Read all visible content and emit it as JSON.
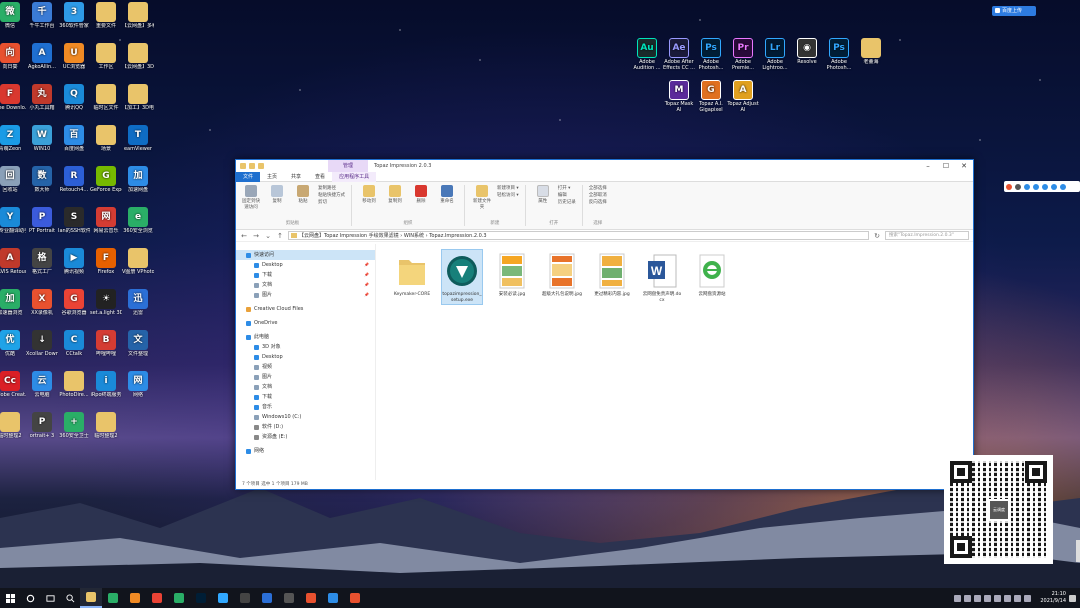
{
  "desktop": {
    "left_icons": [
      {
        "label": "微信",
        "color": "#2aae67",
        "glyph": "微"
      },
      {
        "label": "千牛工作台",
        "color": "#3a7bd5",
        "glyph": "千"
      },
      {
        "label": "360软件管家",
        "color": "#2e9ae6",
        "glyph": "3"
      },
      {
        "label": "重要文件",
        "color": "#e9c46a",
        "glyph": ""
      },
      {
        "label": "【云网盘】多种模式...",
        "color": "#e9c46a",
        "glyph": ""
      },
      {
        "label": "向日葵",
        "color": "#e8512f",
        "glyph": "向"
      },
      {
        "label": "AgkoAllin...",
        "color": "#1f6fd1",
        "glyph": "A"
      },
      {
        "label": "UC浏览器",
        "color": "#f08a24",
        "glyph": "U"
      },
      {
        "label": "工作区",
        "color": "#e9c46a",
        "glyph": ""
      },
      {
        "label": "【云网盘】3D电视...",
        "color": "#e9c46a",
        "glyph": ""
      },
      {
        "label": "Free Downlo...",
        "color": "#d9382f",
        "glyph": "F"
      },
      {
        "label": "小丸工具箱",
        "color": "#c0392b",
        "glyph": "丸"
      },
      {
        "label": "腾讯QQ",
        "color": "#1a8ad8",
        "glyph": "Q"
      },
      {
        "label": "临时区文件",
        "color": "#e9c46a",
        "glyph": ""
      },
      {
        "label": "【加工】3D电视...",
        "color": "#e9c46a",
        "glyph": ""
      },
      {
        "label": "青萌Zeon",
        "color": "#1a9be6",
        "glyph": "Z"
      },
      {
        "label": "WIN10",
        "color": "#3aa0d8",
        "glyph": "W"
      },
      {
        "label": "百度网盘",
        "color": "#2d8ce6",
        "glyph": "百"
      },
      {
        "label": "场景",
        "color": "#e9c46a",
        "glyph": ""
      },
      {
        "label": "eamViewer",
        "color": "#0e6cc4",
        "glyph": "T"
      },
      {
        "label": "回收站",
        "color": "#8aa0b8",
        "glyph": "回"
      },
      {
        "label": "数大师",
        "color": "#2563a8",
        "glyph": "数"
      },
      {
        "label": "Retouch4...",
        "color": "#2c5fd6",
        "glyph": "R"
      },
      {
        "label": "GeForce Experience",
        "color": "#76b900",
        "glyph": "G"
      },
      {
        "label": "加速网盘",
        "color": "#2d8ce6",
        "glyph": "加"
      },
      {
        "label": "有专业翻译助手",
        "color": "#1a8ad8",
        "glyph": "Y"
      },
      {
        "label": "PT Portrait",
        "color": "#3b5bdb",
        "glyph": "P"
      },
      {
        "label": "Ian的SSH软件",
        "color": "#2a2a2a",
        "glyph": "S"
      },
      {
        "label": "网易云音乐",
        "color": "#d43c33",
        "glyph": "网"
      },
      {
        "label": "360安全浏览",
        "color": "#2aae67",
        "glyph": "e"
      },
      {
        "label": "ARVIS Retoucher",
        "color": "#c0392b",
        "glyph": "A"
      },
      {
        "label": "格式工厂",
        "color": "#444",
        "glyph": "格"
      },
      {
        "label": "腾讯视频",
        "color": "#1a8ad8",
        "glyph": "▶"
      },
      {
        "label": "Firefox",
        "color": "#e66000",
        "glyph": "F"
      },
      {
        "label": "V图册 VPhoto看图",
        "color": "#e9c46a",
        "glyph": ""
      },
      {
        "label": "加速器浏览",
        "color": "#2aae67",
        "glyph": "加"
      },
      {
        "label": "XX录像机",
        "color": "#e8512f",
        "glyph": "X"
      },
      {
        "label": "谷歌浏览器",
        "color": "#ea4335",
        "glyph": "G"
      },
      {
        "label": "set.a.light 3D V2.5",
        "color": "#222",
        "glyph": "☀"
      },
      {
        "label": "迅雷",
        "color": "#2b6fd6",
        "glyph": "迅"
      },
      {
        "label": "优酷",
        "color": "#1fa3e8",
        "glyph": "优"
      },
      {
        "label": "Xcollar Downlo...",
        "color": "#333",
        "glyph": "↓"
      },
      {
        "label": "CCtalk",
        "color": "#1a8ad8",
        "glyph": "C"
      },
      {
        "label": "哔哩哔哩",
        "color": "#d43c33",
        "glyph": "B"
      },
      {
        "label": "文件整理",
        "color": "#2563a8",
        "glyph": "文"
      },
      {
        "label": "Adobe Creat...",
        "color": "#da1f26",
        "glyph": "Cc"
      },
      {
        "label": "云电脑",
        "color": "#2d8ce6",
        "glyph": "云"
      },
      {
        "label": "PhotoDire...",
        "color": "#e9c46a",
        "glyph": ""
      },
      {
        "label": "iRpo终端服务",
        "color": "#1a8ad8",
        "glyph": "i"
      },
      {
        "label": "网络",
        "color": "#2d8ce6",
        "glyph": "网"
      },
      {
        "label": "临时整理2",
        "color": "#e9c46a",
        "glyph": ""
      },
      {
        "label": "ortrait+ 3",
        "color": "#444",
        "glyph": "P"
      },
      {
        "label": "360安全卫士",
        "color": "#2aae67",
        "glyph": "+"
      },
      {
        "label": "临时整理2",
        "color": "#e9c46a",
        "glyph": ""
      }
    ],
    "right_icons": [
      {
        "label": "Adobe Audition ...",
        "color": "#00e4bb",
        "glyph": "Au",
        "bg": "#1a2a2a"
      },
      {
        "label": "Adobe After Effects CC ...",
        "color": "#9999ff",
        "glyph": "Ae",
        "bg": "#1a1a3a"
      },
      {
        "label": "Adobe Photosh...",
        "color": "#31a8ff",
        "glyph": "Ps",
        "bg": "#001e36"
      },
      {
        "label": "Adobe Premie...",
        "color": "#ea77ff",
        "glyph": "Pr",
        "bg": "#2a0a3a"
      },
      {
        "label": "Adobe Lightroo...",
        "color": "#31a8ff",
        "glyph": "Lr",
        "bg": "#001a33"
      },
      {
        "label": "Resolve",
        "color": "#fff",
        "glyph": "◉",
        "bg": "#333"
      },
      {
        "label": "Adobe Photosh...",
        "color": "#31a8ff",
        "glyph": "Ps",
        "bg": "#001e36"
      },
      {
        "label": "老董海",
        "color": "#e9c46a",
        "glyph": "",
        "bg": "#e9c46a"
      },
      {
        "label": "Topaz Mask AI",
        "color": "#fff",
        "glyph": "M",
        "bg": "#5b2b9a"
      },
      {
        "label": "Topaz A.I. Gigapixel",
        "color": "#fff",
        "glyph": "G",
        "bg": "#e07020"
      },
      {
        "label": "Topaz Adjust AI",
        "color": "#fff",
        "glyph": "A",
        "bg": "#e0a020"
      }
    ],
    "top_badge": "百度上传",
    "qr_logo_text": "云调度"
  },
  "window": {
    "manage_tab": "管理",
    "title": "Topaz Impression 2.0.3",
    "controls": [
      "–",
      "☐",
      "✕"
    ],
    "tabs": [
      "文件",
      "主页",
      "共享",
      "查看",
      "应用程序工具"
    ],
    "ribbon": {
      "clipboard": {
        "label": "剪贴板",
        "buttons": [
          "固定到快速访问",
          "复制",
          "粘贴"
        ],
        "small": [
          "复制路径",
          "粘贴快捷方式",
          "剪切"
        ]
      },
      "organize": {
        "label": "组织",
        "buttons": [
          "移动到",
          "复制到",
          "删除",
          "重命名"
        ]
      },
      "new": {
        "label": "新建",
        "buttons": [
          "新建文件夹"
        ],
        "small": [
          "新建项目 ▾",
          "轻松访问 ▾"
        ]
      },
      "open": {
        "label": "打开",
        "buttons": [
          "属性"
        ],
        "small": [
          "打开 ▾",
          "编辑",
          "历史记录"
        ]
      },
      "select": {
        "label": "选择",
        "small": [
          "全部选择",
          "全部取消",
          "反向选择"
        ]
      }
    },
    "address": "【云网盘】Topaz Impression 手绘效果滤镜  ›  WIN系统  ›  Topaz.Impression.2.0.3",
    "search_placeholder": "搜索\"Topaz.Impression.2.0.3\"",
    "nav": [
      {
        "label": "快速访问",
        "color": "#2d8ce6",
        "sub": false,
        "sel": true,
        "pin": false
      },
      {
        "label": "Desktop",
        "color": "#2d8ce6",
        "sub": true,
        "sel": false,
        "pin": true
      },
      {
        "label": "下载",
        "color": "#2d8ce6",
        "sub": true,
        "sel": false,
        "pin": true
      },
      {
        "label": "文档",
        "color": "#8aa0b8",
        "sub": true,
        "sel": false,
        "pin": true
      },
      {
        "label": "图片",
        "color": "#8aa0b8",
        "sub": true,
        "sel": false,
        "pin": true
      },
      {
        "label": "",
        "gap": true
      },
      {
        "label": "Creative Cloud Files",
        "color": "#e9a13a",
        "sub": false,
        "sel": false,
        "pin": false
      },
      {
        "label": "",
        "gap": true
      },
      {
        "label": "OneDrive",
        "color": "#2d8ce6",
        "sub": false,
        "sel": false,
        "pin": false
      },
      {
        "label": "",
        "gap": true
      },
      {
        "label": "此电脑",
        "color": "#2d8ce6",
        "sub": false,
        "sel": false,
        "pin": false
      },
      {
        "label": "3D 对象",
        "color": "#2d8ce6",
        "sub": true,
        "sel": false,
        "pin": false
      },
      {
        "label": "Desktop",
        "color": "#2d8ce6",
        "sub": true,
        "sel": false,
        "pin": false
      },
      {
        "label": "视频",
        "color": "#8aa0b8",
        "sub": true,
        "sel": false,
        "pin": false
      },
      {
        "label": "图片",
        "color": "#8aa0b8",
        "sub": true,
        "sel": false,
        "pin": false
      },
      {
        "label": "文档",
        "color": "#8aa0b8",
        "sub": true,
        "sel": false,
        "pin": false
      },
      {
        "label": "下载",
        "color": "#2d8ce6",
        "sub": true,
        "sel": false,
        "pin": false
      },
      {
        "label": "音乐",
        "color": "#2d8ce6",
        "sub": true,
        "sel": false,
        "pin": false
      },
      {
        "label": "Windows10 (C:)",
        "color": "#8aa0b8",
        "sub": true,
        "sel": false,
        "pin": false
      },
      {
        "label": "软件 (D:)",
        "color": "#888",
        "sub": true,
        "sel": false,
        "pin": false
      },
      {
        "label": "资源盘 (E:)",
        "color": "#888",
        "sub": true,
        "sel": false,
        "pin": false
      },
      {
        "label": "",
        "gap": true
      },
      {
        "label": "网络",
        "color": "#2d8ce6",
        "sub": false,
        "sel": false,
        "pin": false
      }
    ],
    "files": [
      {
        "name": "Keymaker-CORE",
        "kind": "folder",
        "selected": false
      },
      {
        "name": "topazimpression_setup.exe",
        "kind": "exe",
        "selected": true
      },
      {
        "name": "安装必读.jpg",
        "kind": "img1",
        "selected": false
      },
      {
        "name": "超级大礼包说明.jpg",
        "kind": "img2",
        "selected": false
      },
      {
        "name": "更过精彩内容.jpg",
        "kind": "img3",
        "selected": false
      },
      {
        "name": "云网盘免责声明.docx",
        "kind": "word",
        "selected": false
      },
      {
        "name": "云网盘资源站",
        "kind": "ie",
        "selected": false
      }
    ],
    "status": "7 个项目    选中 1 个项目  179 MB"
  },
  "taskbar": {
    "apps": [
      {
        "color": "#e9c46a",
        "active": true
      },
      {
        "color": "#2aae67",
        "active": false
      },
      {
        "color": "#f08a24",
        "active": false
      },
      {
        "color": "#ea4335",
        "active": false
      },
      {
        "color": "#2aae67",
        "active": false
      },
      {
        "color": "#001e36",
        "active": false
      },
      {
        "color": "#31a8ff",
        "active": false
      },
      {
        "color": "#444",
        "active": false
      },
      {
        "color": "#2b6fd6",
        "active": false
      },
      {
        "color": "#555",
        "active": false
      },
      {
        "color": "#e8512f",
        "active": false
      },
      {
        "color": "#2d8ce6",
        "active": false
      },
      {
        "color": "#e8512f",
        "active": false
      }
    ],
    "time": "21:10",
    "date": "2021/9/14"
  }
}
